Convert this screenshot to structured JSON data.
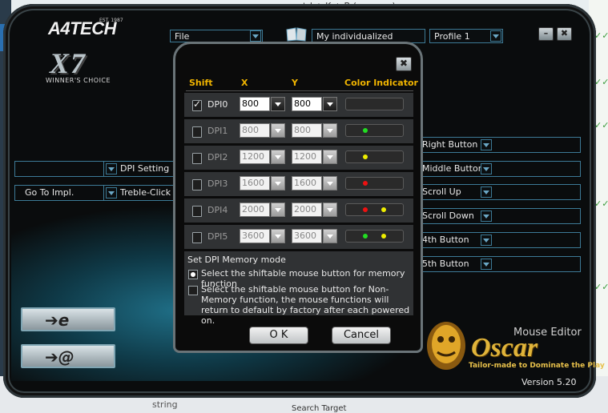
{
  "background": {
    "top_text": "trl + K + B (uo auan)",
    "bottom_left": "string",
    "bottom_text": "Search Target"
  },
  "brand": {
    "logo": "A4TECH",
    "est": "EST. 1987",
    "model": "X7",
    "slogan": "WINNER'S CHOICE"
  },
  "toolbar": {
    "file_label": "File",
    "profile_name": "My individualized mouse",
    "profile_select": "Profile 1",
    "minimize_label": "–",
    "close_label": "✖"
  },
  "left_panel": {
    "dpi_setting": "DPI Setting",
    "go_to_impl": "Go To Impl.",
    "treble_click": "Treble-Click"
  },
  "right_buttons": [
    "Right Button",
    "Middle Button",
    "Scroll Up",
    "Scroll Down",
    "4th Button",
    "5th Button"
  ],
  "oscar": {
    "title": "Mouse Editor",
    "name": "Oscar",
    "tagline": "Tailor-made to Dominate the Play",
    "version": "Version 5.20"
  },
  "dialog": {
    "close_label": "✖",
    "headers": {
      "shift": "Shift",
      "x": "X",
      "y": "Y",
      "color": "Color Indicator"
    },
    "rows": [
      {
        "label": "DPI0",
        "x": "800",
        "y": "800",
        "checked": true
      },
      {
        "label": "DPI1",
        "x": "800",
        "y": "800",
        "checked": false
      },
      {
        "label": "DPI2",
        "x": "1200",
        "y": "1200",
        "checked": false
      },
      {
        "label": "DPI3",
        "x": "1600",
        "y": "1600",
        "checked": false
      },
      {
        "label": "DPI4",
        "x": "2000",
        "y": "2000",
        "checked": false
      },
      {
        "label": "DPI5",
        "x": "3600",
        "y": "3600",
        "checked": false
      }
    ],
    "led_colors": {
      "green": "#22dd22",
      "yellow": "#eeee00",
      "red": "#ee1111"
    },
    "memory": {
      "title": "Set DPI Memory mode",
      "option_memory": "Select the shiftable mouse button for memory function",
      "option_non_memory": "Select the shiftable mouse button for Non-Memory function, the mouse functions will return to default by factory after each powered on."
    },
    "ok_label": "O K",
    "cancel_label": "Cancel"
  }
}
